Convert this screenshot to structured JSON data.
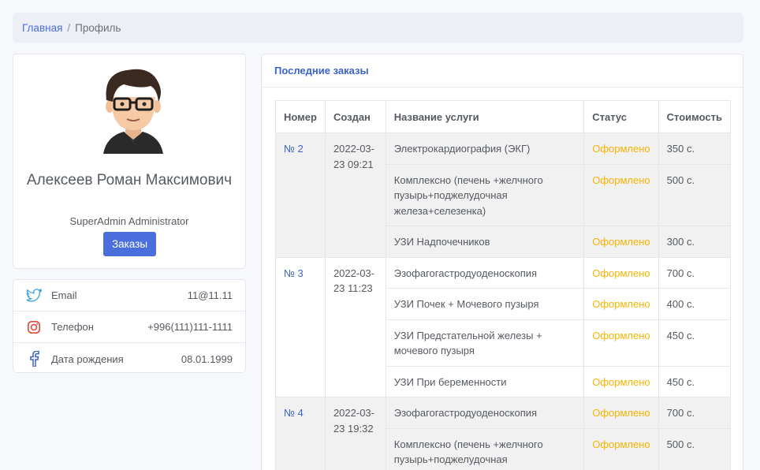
{
  "breadcrumb": {
    "home": "Главная",
    "separator": "/",
    "current": "Профиль"
  },
  "profile": {
    "name": "Алексеев Роман Максимович",
    "role": "SuperAdmin Administrator",
    "orders_button": "Заказы"
  },
  "contacts": [
    {
      "icon": "twitter-icon",
      "label": "Email",
      "value": "11@11.11"
    },
    {
      "icon": "instagram-icon",
      "label": "Телефон",
      "value": "+996(111)111-1111"
    },
    {
      "icon": "facebook-icon",
      "label": "Дата рождения",
      "value": "08.01.1999"
    }
  ],
  "orders": {
    "title": "Последние заказы",
    "columns": [
      "Номер",
      "Создан",
      "Название услуги",
      "Статус",
      "Стоимость"
    ],
    "groups": [
      {
        "number": "№ 2",
        "created": "2022-03-23 09:21",
        "items": [
          {
            "service": "Электрокардиография (ЭКГ)",
            "status": "Оформлено",
            "price": "350 с."
          },
          {
            "service": "Комплексно (печень +желчного пузырь+поджелудочная железа+селезенка)",
            "status": "Оформлено",
            "price": "500 с."
          },
          {
            "service": "УЗИ Надпочечников",
            "status": "Оформлено",
            "price": "300 с."
          }
        ]
      },
      {
        "number": "№ 3",
        "created": "2022-03-23 11:23",
        "items": [
          {
            "service": "Эзофагогастродуоденоскопия",
            "status": "Оформлено",
            "price": "700 с."
          },
          {
            "service": "УЗИ Почек + Мочевого пузыря",
            "status": "Оформлено",
            "price": "400 с."
          },
          {
            "service": "УЗИ Предстательной железы + мочевого пузыря",
            "status": "Оформлено",
            "price": "450 с."
          },
          {
            "service": "УЗИ При беременности",
            "status": "Оформлено",
            "price": "450 с."
          }
        ]
      },
      {
        "number": "№ 4",
        "created": "2022-03-23 19:32",
        "items": [
          {
            "service": "Эзофагогастродуоденоскопия",
            "status": "Оформлено",
            "price": "700 с."
          },
          {
            "service": "Комплексно (печень +желчного пузырь+поджелудочная железа+селезенка)",
            "status": "Оформлено",
            "price": "500 с."
          }
        ]
      }
    ]
  },
  "colors": {
    "accent": "#4a6fdc",
    "link": "#3b63c9",
    "status": "#f5b400"
  }
}
